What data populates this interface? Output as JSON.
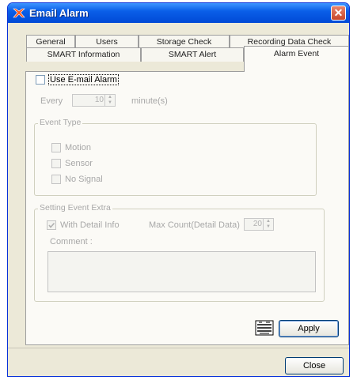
{
  "window": {
    "title": "Email Alarm",
    "close_glyph": "✕"
  },
  "tabs": {
    "row1": [
      "General",
      "Users",
      "Storage Check",
      "Recording Data Check"
    ],
    "row2": [
      "SMART Information",
      "SMART Alert",
      "Alarm Event"
    ],
    "active": "Alarm Event"
  },
  "alarm_event": {
    "use_email_alarm_label": "Use E-mail Alarm",
    "use_email_alarm_checked": false,
    "every_label": "Every",
    "every_value": "10",
    "every_unit": "minute(s)",
    "event_type": {
      "legend": "Event Type",
      "options": [
        "Motion",
        "Sensor",
        "No Signal"
      ]
    },
    "setting_event_extra": {
      "legend": "Setting Event Extra",
      "with_detail_info_label": "With Detail Info",
      "with_detail_info_checked": true,
      "max_count_label": "Max Count(Detail Data)",
      "max_count_value": "20",
      "comment_label": "Comment :"
    }
  },
  "buttons": {
    "apply": "Apply",
    "close": "Close"
  },
  "icons": {
    "title": "app-logo-icon",
    "apply_side": "logo-icon"
  }
}
